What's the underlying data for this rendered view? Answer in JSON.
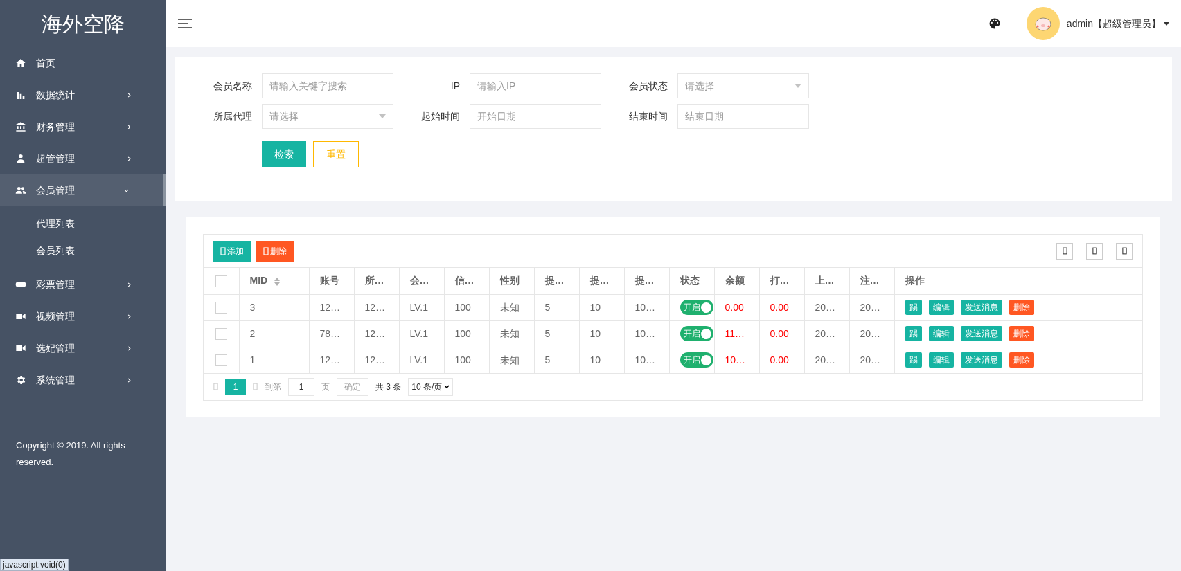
{
  "sidebar": {
    "logo": "海外空降",
    "items": [
      {
        "label": "首页",
        "has_submenu": false,
        "selected": false
      },
      {
        "label": "数据统计",
        "has_submenu": true,
        "expanded": false,
        "selected": false
      },
      {
        "label": "财务管理",
        "has_submenu": true,
        "expanded": false,
        "selected": false
      },
      {
        "label": "超管管理",
        "has_submenu": true,
        "expanded": false,
        "selected": false
      },
      {
        "label": "会员管理",
        "has_submenu": true,
        "expanded": true,
        "selected": true,
        "children": [
          {
            "label": "代理列表"
          },
          {
            "label": "会员列表"
          }
        ]
      },
      {
        "label": "彩票管理",
        "has_submenu": true,
        "expanded": false,
        "selected": false
      },
      {
        "label": "视频管理",
        "has_submenu": true,
        "expanded": false,
        "selected": false
      },
      {
        "label": "选妃管理",
        "has_submenu": true,
        "expanded": false,
        "selected": false
      },
      {
        "label": "系统管理",
        "has_submenu": true,
        "expanded": false,
        "selected": false
      }
    ],
    "copyright": "Copyright © 2019. All rights reserved."
  },
  "header": {
    "user": "admin【超级管理员】"
  },
  "filters": [
    {
      "label": "会员名称",
      "placeholder": "请输入关键字搜索",
      "kind": "input"
    },
    {
      "label": "IP",
      "placeholder": "请输入IP",
      "kind": "input"
    },
    {
      "label": "会员状态",
      "placeholder": "请选择",
      "kind": "select"
    },
    {
      "label": "所属代理",
      "placeholder": "请选择",
      "kind": "select"
    },
    {
      "label": "起始时间",
      "placeholder": "开始日期",
      "kind": "input"
    },
    {
      "label": "结束时间",
      "placeholder": "结束日期",
      "kind": "input"
    }
  ],
  "filter_buttons": [
    {
      "label": "检索",
      "kind": "primary"
    },
    {
      "label": "重置",
      "kind": "warning"
    }
  ],
  "toolbar": [
    {
      "label": "添加",
      "kind": "primary"
    },
    {
      "label": "删除",
      "kind": "danger"
    }
  ],
  "table": {
    "select_all_checked": false,
    "columns": [
      {
        "label": "MID",
        "kind": "text",
        "sortable": true
      },
      {
        "label": "账号",
        "kind": "text",
        "sortable": false
      },
      {
        "label": "所…",
        "kind": "text",
        "sortable": false
      },
      {
        "label": "会…",
        "kind": "text",
        "sortable": false
      },
      {
        "label": "信…",
        "kind": "text",
        "sortable": false
      },
      {
        "label": "性别",
        "kind": "text",
        "sortable": false
      },
      {
        "label": "提…",
        "kind": "text",
        "sortable": false
      },
      {
        "label": "提…",
        "kind": "text",
        "sortable": false
      },
      {
        "label": "提…",
        "kind": "text",
        "sortable": false
      },
      {
        "label": "状态",
        "kind": "switch",
        "sortable": false
      },
      {
        "label": "余额",
        "kind": "money",
        "sortable": false
      },
      {
        "label": "打…",
        "kind": "money",
        "sortable": false
      },
      {
        "label": "上…",
        "kind": "text",
        "sortable": false
      },
      {
        "label": "注…",
        "kind": "text",
        "sortable": false
      },
      {
        "label": "操作",
        "kind": "actions",
        "sortable": false
      }
    ],
    "rows": [
      {
        "checked": false,
        "cells": [
          "3",
          "12…",
          "12…",
          "LV.1",
          "100",
          "未知",
          "5",
          "10",
          "10…",
          {
            "label": "开启",
            "on": true
          },
          "0.00",
          "0.00",
          "20…",
          "20…",
          [
            {
              "label": "踢",
              "kind": "primary"
            },
            {
              "label": "编辑",
              "kind": "primary"
            },
            {
              "label": "发送消息",
              "kind": "primary"
            },
            {
              "label": "删除",
              "kind": "danger"
            }
          ]
        ]
      },
      {
        "checked": false,
        "cells": [
          "2",
          "78…",
          "12…",
          "LV.1",
          "100",
          "未知",
          "5",
          "10",
          "10…",
          {
            "label": "开启",
            "on": true
          },
          "11…",
          "0.00",
          "20…",
          "20…",
          [
            {
              "label": "踢",
              "kind": "primary"
            },
            {
              "label": "编辑",
              "kind": "primary"
            },
            {
              "label": "发送消息",
              "kind": "primary"
            },
            {
              "label": "删除",
              "kind": "danger"
            }
          ]
        ]
      },
      {
        "checked": false,
        "cells": [
          "1",
          "12…",
          "12…",
          "LV.1",
          "100",
          "未知",
          "5",
          "10",
          "10…",
          {
            "label": "开启",
            "on": true
          },
          "10…",
          "0.00",
          "20…",
          "20…",
          [
            {
              "label": "踢",
              "kind": "primary"
            },
            {
              "label": "编辑",
              "kind": "primary"
            },
            {
              "label": "发送消息",
              "kind": "primary"
            },
            {
              "label": "删除",
              "kind": "danger"
            }
          ]
        ]
      }
    ]
  },
  "pagination": {
    "pages": [
      {
        "label": "1",
        "selected": true
      }
    ],
    "goto_label": "到第",
    "goto_value": "1",
    "page_unit": "页",
    "confirm": "确定",
    "total": "共 3 条",
    "page_size": "10 条/页"
  },
  "status_url": "javascript:void(0)"
}
